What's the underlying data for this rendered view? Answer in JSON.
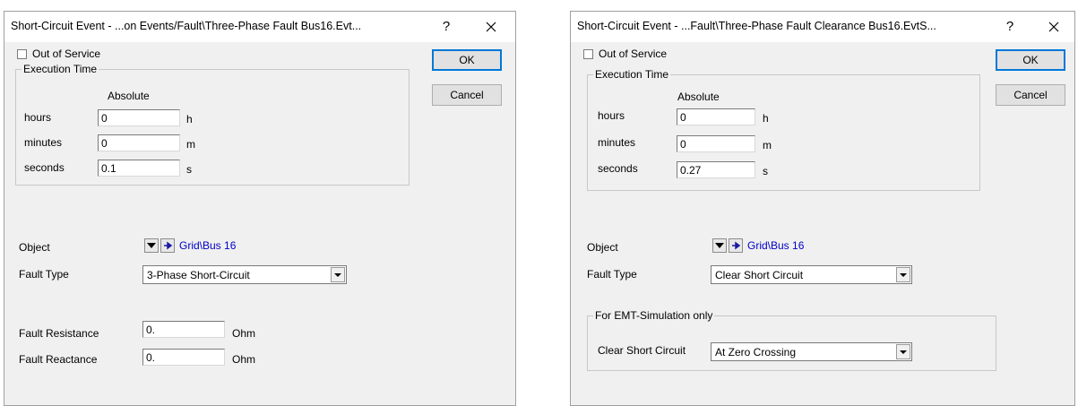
{
  "dialog1": {
    "title": "Short-Circuit Event - ...on Events/Fault\\Three-Phase Fault Bus16.Evt...",
    "help": "?",
    "out_of_service": "Out of Service",
    "ok": "OK",
    "cancel": "Cancel",
    "execution_time": {
      "legend": "Execution Time",
      "mode": "Absolute",
      "hours_label": "hours",
      "hours_value": "0",
      "hours_unit": "h",
      "minutes_label": "minutes",
      "minutes_value": "0",
      "minutes_unit": "m",
      "seconds_label": "seconds",
      "seconds_value": "0.1",
      "seconds_unit": "s"
    },
    "object_label": "Object",
    "object_value": "Grid\\Bus 16",
    "fault_type_label": "Fault Type",
    "fault_type_value": "3-Phase Short-Circuit",
    "fault_resistance_label": "Fault Resistance",
    "fault_resistance_value": "0.",
    "fault_resistance_unit": "Ohm",
    "fault_reactance_label": "Fault Reactance",
    "fault_reactance_value": "0.",
    "fault_reactance_unit": "Ohm"
  },
  "dialog2": {
    "title": "Short-Circuit Event - ...Fault\\Three-Phase Fault Clearance Bus16.EvtS...",
    "help": "?",
    "out_of_service": "Out of Service",
    "ok": "OK",
    "cancel": "Cancel",
    "execution_time": {
      "legend": "Execution Time",
      "mode": "Absolute",
      "hours_label": "hours",
      "hours_value": "0",
      "hours_unit": "h",
      "minutes_label": "minutes",
      "minutes_value": "0",
      "minutes_unit": "m",
      "seconds_label": "seconds",
      "seconds_value": "0.27",
      "seconds_unit": "s"
    },
    "object_label": "Object",
    "object_value": "Grid\\Bus 16",
    "fault_type_label": "Fault Type",
    "fault_type_value": "Clear Short Circuit",
    "emt_legend": "For EMT-Simulation only",
    "clear_sc_label": "Clear Short Circuit",
    "clear_sc_value": "At Zero Crossing"
  },
  "icons": [
    "checkbox-icon",
    "close-icon",
    "dropdown-arrow-icon",
    "jump-to-arrow-icon",
    "chevron-down-icon"
  ],
  "colors": {
    "accent": "#0078d7",
    "link": "#0000c8",
    "dialog_bg": "#f0f0f0"
  }
}
